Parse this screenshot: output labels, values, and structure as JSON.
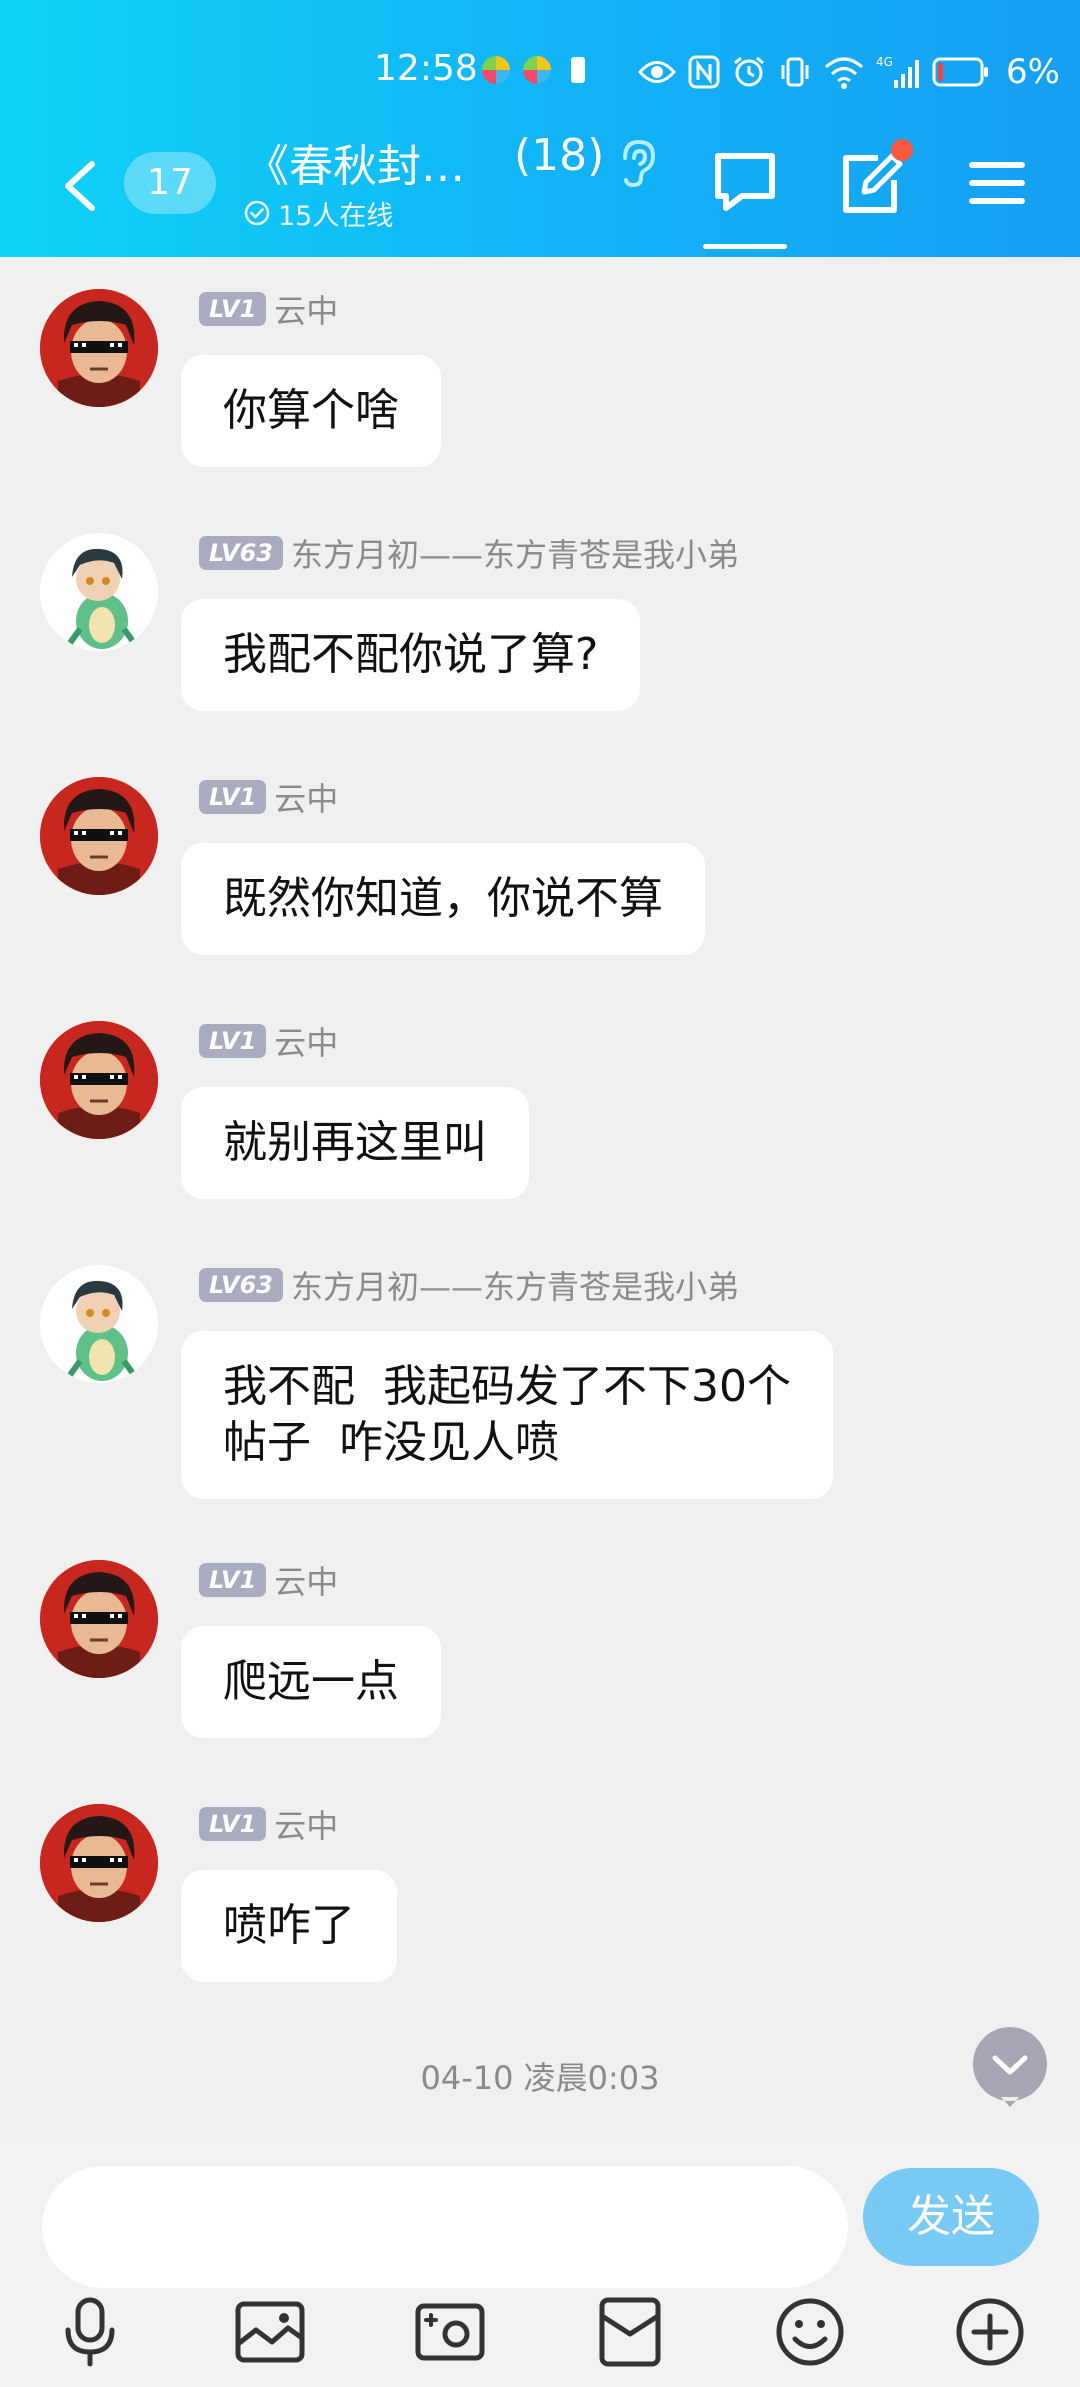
{
  "status_bar": {
    "time": "12:58",
    "network": "4G",
    "battery_percent": "6%"
  },
  "header": {
    "unread_count": "17",
    "group_title": "《春秋封…",
    "member_count": "(18)",
    "online_status": "15人在线"
  },
  "messages": [
    {
      "level": "LV1",
      "sender": "云中",
      "text": "你算个啥",
      "avatar": "red-sunglasses"
    },
    {
      "level": "LV63",
      "sender": "东方月初——东方青苍是我小弟",
      "text": "我配不配你说了算?",
      "avatar": "green-dino-costume"
    },
    {
      "level": "LV1",
      "sender": "云中",
      "text": "既然你知道，你说不算",
      "avatar": "red-sunglasses"
    },
    {
      "level": "LV1",
      "sender": "云中",
      "text": "就别再这里叫",
      "avatar": "red-sunglasses"
    },
    {
      "level": "LV63",
      "sender": "东方月初——东方青苍是我小弟",
      "text": "我不配  我起码发了不下30个\n帖子  咋没见人喷",
      "avatar": "green-dino-costume"
    },
    {
      "level": "LV1",
      "sender": "云中",
      "text": "爬远一点",
      "avatar": "red-sunglasses"
    },
    {
      "level": "LV1",
      "sender": "云中",
      "text": "喷咋了",
      "avatar": "red-sunglasses"
    }
  ],
  "timestamp": "04-10 凌晨0:03",
  "input": {
    "value": "",
    "placeholder": "",
    "send_label": "发送"
  },
  "toolbar": [
    "mic-icon",
    "image-icon",
    "photo-icon",
    "gift-icon",
    "emoji-icon",
    "plus-icon"
  ],
  "colors": {
    "header_gradient_start": "#0fd2f6",
    "header_gradient_end": "#16a0f4",
    "level_badge": "#a9acbf",
    "send_button": "#79c9f5",
    "notification_dot": "#f85a3e"
  }
}
